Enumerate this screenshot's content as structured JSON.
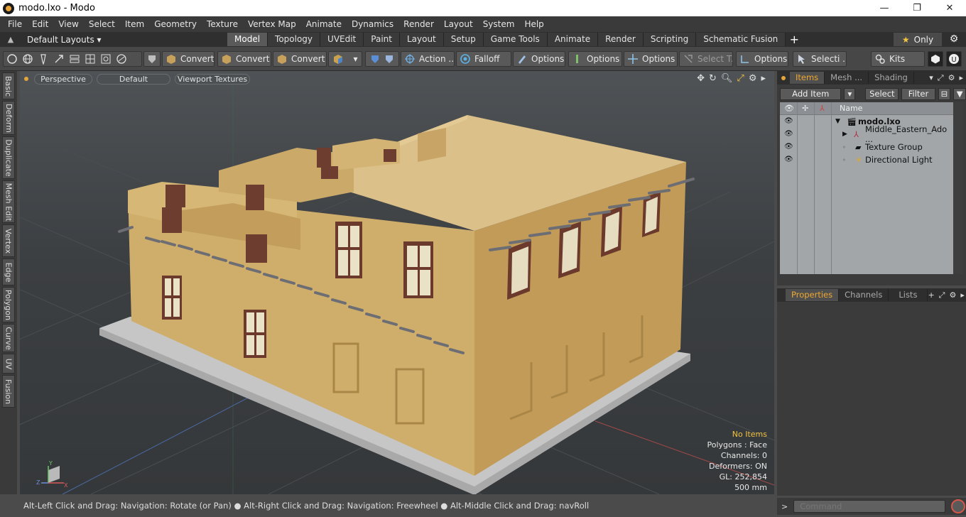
{
  "window": {
    "title": "modo.lxo - Modo",
    "minimize": "—",
    "maximize": "❐",
    "close": "✕"
  },
  "menu": [
    "File",
    "Edit",
    "View",
    "Select",
    "Item",
    "Geometry",
    "Texture",
    "Vertex Map",
    "Animate",
    "Dynamics",
    "Render",
    "Layout",
    "System",
    "Help"
  ],
  "layouts": {
    "label": "Default Layouts ▾"
  },
  "layout_tabs": [
    "Model",
    "Topology",
    "UVEdit",
    "Paint",
    "Layout",
    "Setup",
    "Game Tools",
    "Animate",
    "Render",
    "Scripting",
    "Schematic Fusion"
  ],
  "active_layout_tab": "Model",
  "only_label": "Only",
  "toolbar": {
    "convert1": "Convert",
    "convert2": "Convert",
    "convert3": "Convert",
    "action": "Action ...",
    "falloff": "Falloff",
    "options1": "Options",
    "options2": "Options",
    "options3": "Options",
    "select_t": "Select T...",
    "options4": "Options",
    "selecti": "Selecti ...",
    "kits": "Kits"
  },
  "vertical_tabs": [
    "Basic",
    "Deform",
    "Duplicate",
    "Mesh Edit",
    "Vertex",
    "Edge",
    "Polygon",
    "Curve",
    "UV",
    "Fusion"
  ],
  "viewport": {
    "mode": "Perspective",
    "style": "Default",
    "textures": "Viewport Textures",
    "info": {
      "selection": "No Items",
      "polygons": "Polygons : Face",
      "channels": "Channels: 0",
      "deformers": "Deformers: ON",
      "gl": "GL: 252,854",
      "scale": "500 mm"
    }
  },
  "status_bar": "Alt-Left Click and Drag: Navigation: Rotate (or Pan) ● Alt-Right Click and Drag: Navigation: Freewheel ● Alt-Middle Click and Drag: navRoll",
  "items_panel": {
    "tabs": [
      "Items",
      "Mesh ...",
      "Shading"
    ],
    "add_item": "Add Item",
    "select": "Select",
    "filter": "Filter",
    "column_name": "Name",
    "rows": [
      "modo.lxo",
      "Middle_Eastern_Ado ...",
      "Texture Group",
      "Directional Light"
    ]
  },
  "properties_panel": {
    "tabs": [
      "Properties",
      "Channels",
      "Lists"
    ]
  },
  "command": {
    "placeholder": "Command"
  },
  "colors": {
    "accent": "#f0a830",
    "viewport_bg": "#3c3f42",
    "panel_bg": "#3b3b3b"
  }
}
